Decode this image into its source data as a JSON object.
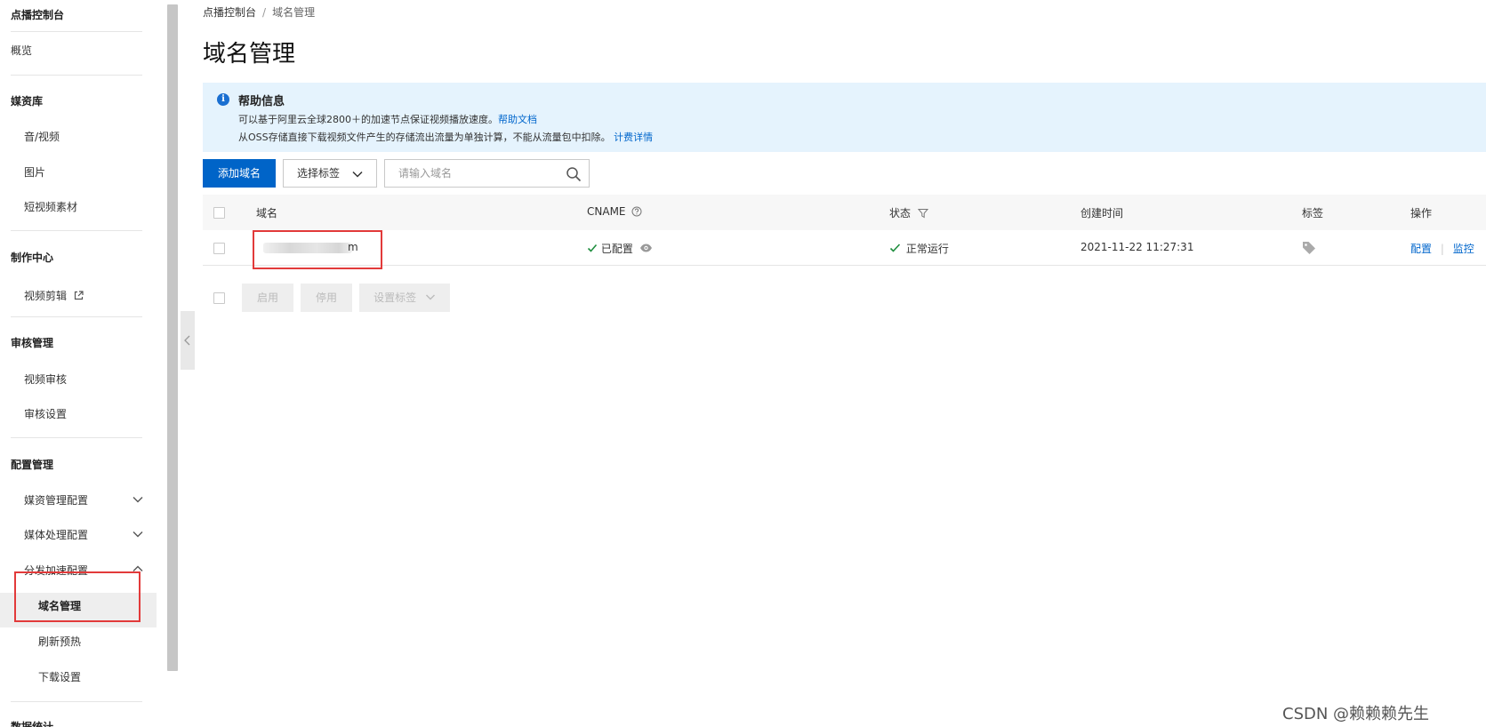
{
  "sidebar": {
    "header": "点播控制台",
    "overview": "概览",
    "media_library": {
      "title": "媒资库",
      "items": [
        "音/视频",
        "图片",
        "短视频素材"
      ]
    },
    "production": {
      "title": "制作中心",
      "items": [
        "视频剪辑"
      ]
    },
    "review": {
      "title": "审核管理",
      "items": [
        "视频审核",
        "审核设置"
      ]
    },
    "config": {
      "title": "配置管理",
      "items": [
        "媒资管理配置",
        "媒体处理配置",
        "分发加速配置"
      ],
      "subitems": [
        "域名管理",
        "刷新预热",
        "下载设置"
      ]
    },
    "next_section_partial": "数据统计"
  },
  "breadcrumb": {
    "root": "点播控制台",
    "separator": "/",
    "current": "域名管理"
  },
  "page": {
    "title": "域名管理"
  },
  "help": {
    "title": "帮助信息",
    "line1_text": "可以基于阿里云全球2800＋的加速节点保证视频播放速度。",
    "line1_link": "帮助文档",
    "line2_text": "从OSS存储直接下载视频文件产生的存储流出流量为单独计算，不能从流量包中扣除。",
    "line2_link": "计费详情"
  },
  "toolbar": {
    "add_domain": "添加域名",
    "select_tag": "选择标签",
    "search_placeholder": "请输入域名"
  },
  "table": {
    "headers": {
      "domain": "域名",
      "cname": "CNAME",
      "status": "状态",
      "created": "创建时间",
      "tag": "标签",
      "action": "操作"
    },
    "rows": [
      {
        "domain_suffix": "m",
        "cname": "已配置",
        "status": "正常运行",
        "created": "2021-11-22 11:27:31",
        "action_config": "配置",
        "action_monitor": "监控"
      }
    ]
  },
  "bulk": {
    "enable": "启用",
    "disable": "停用",
    "set_tag": "设置标签"
  },
  "watermark": "CSDN @赖赖赖先生",
  "colors": {
    "primary": "#0064c8",
    "link": "#0066cc",
    "help_bg": "#e5f3fd",
    "success": "#1e8e3e",
    "highlight": "#e23a3a"
  }
}
